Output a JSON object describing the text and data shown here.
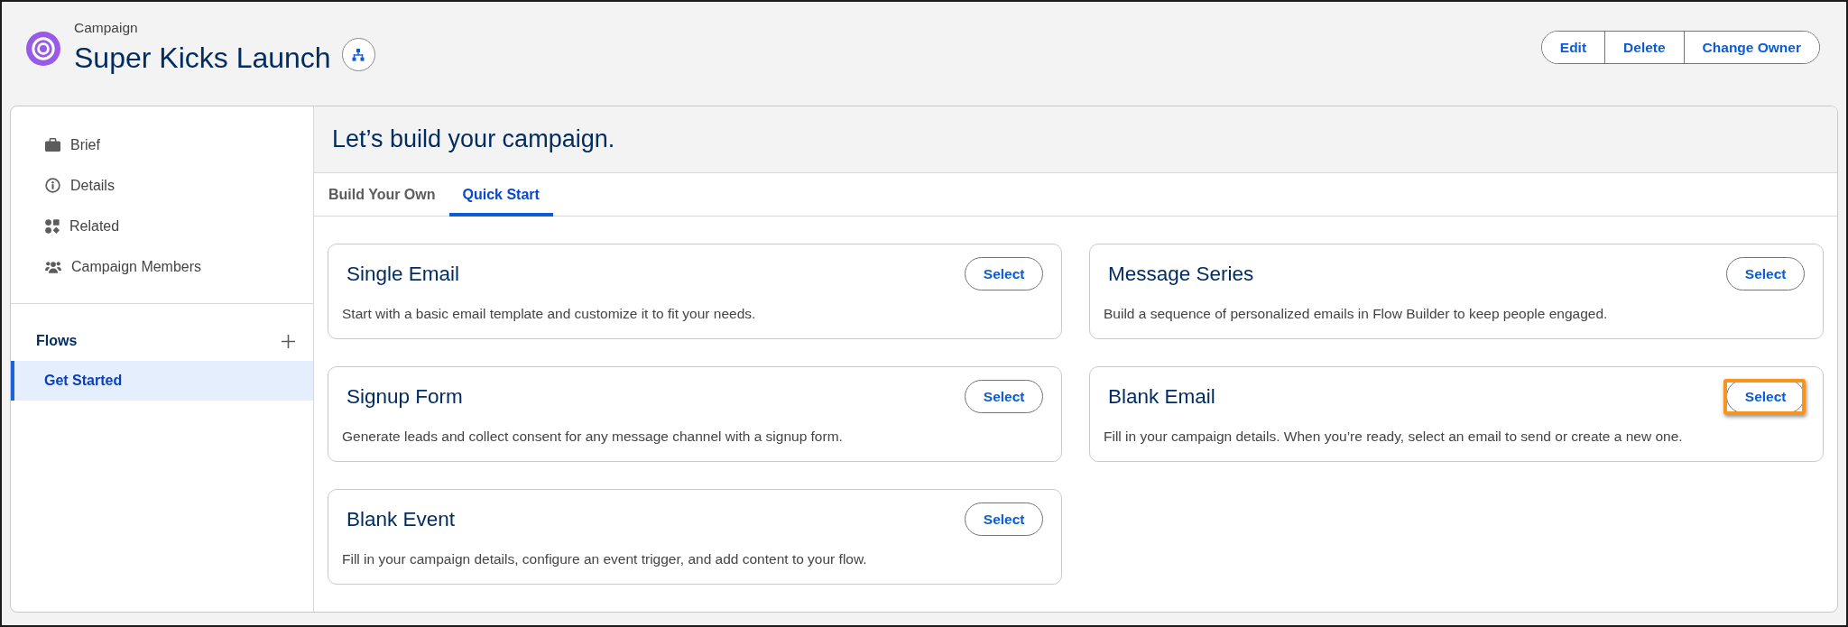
{
  "header": {
    "object_type": "Campaign",
    "title": "Super Kicks Launch",
    "actions": [
      {
        "label": "Edit"
      },
      {
        "label": "Delete"
      },
      {
        "label": "Change Owner"
      }
    ]
  },
  "sidebar": {
    "items": [
      {
        "label": "Brief"
      },
      {
        "label": "Details"
      },
      {
        "label": "Related"
      },
      {
        "label": "Campaign Members"
      }
    ],
    "flows": {
      "title": "Flows",
      "items": [
        {
          "label": "Get Started",
          "selected": true
        }
      ]
    }
  },
  "main": {
    "heading": "Let’s build your campaign.",
    "tabs": [
      {
        "label": "Build Your Own",
        "selected": false
      },
      {
        "label": "Quick Start",
        "selected": true
      }
    ],
    "cards": [
      {
        "title": "Single Email",
        "description": "Start with a basic email template and customize it to fit your needs.",
        "button": "Select",
        "highlighted": false
      },
      {
        "title": "Message Series",
        "description": "Build a sequence of personalized emails in Flow Builder to keep people engaged.",
        "button": "Select",
        "highlighted": false
      },
      {
        "title": "Signup Form",
        "description": "Generate leads and collect consent for any message channel with a signup form.",
        "button": "Select",
        "highlighted": false
      },
      {
        "title": "Blank Email",
        "description": "Fill in your campaign details. When you’re ready, select an email to send or create a new one.",
        "button": "Select",
        "highlighted": true
      },
      {
        "title": "Blank Event",
        "description": "Fill in your campaign details, configure an event trigger, and add content to your flow.",
        "button": "Select",
        "highlighted": false
      }
    ]
  }
}
